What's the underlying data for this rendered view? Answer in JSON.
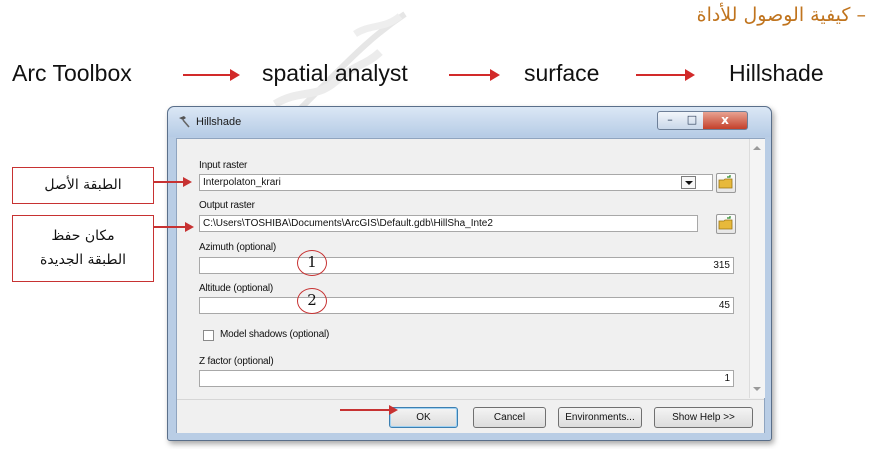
{
  "heading": "– كيفية الوصول للأداة",
  "path": {
    "steps": [
      "Arc Toolbox",
      "spatial analyst",
      "surface",
      "Hillshade"
    ]
  },
  "dialog": {
    "title": "Hillshade",
    "window_buttons": {
      "minimize": "–",
      "maximize": "□",
      "close": "x"
    },
    "input_raster": {
      "label": "Input raster",
      "value": "Interpolaton_krari"
    },
    "output_raster": {
      "label": "Output raster",
      "value": "C:\\Users\\TOSHIBA\\Documents\\ArcGIS\\Default.gdb\\HillSha_Inte2"
    },
    "azimuth": {
      "label": "Azimuth (optional)",
      "value": "315"
    },
    "altitude": {
      "label": "Altitude (optional)",
      "value": "45"
    },
    "model_shadows": {
      "label": "Model shadows (optional)",
      "checked": false
    },
    "z_factor": {
      "label": "Z factor (optional)",
      "value": "1"
    },
    "buttons": {
      "ok": "OK",
      "cancel": "Cancel",
      "environments": "Environments...",
      "show_help": "Show Help >>"
    }
  },
  "callouts": {
    "input": [
      "الطبقة الأصل"
    ],
    "output": [
      "مكان حفظ",
      "الطبقة الجديدة"
    ]
  },
  "markers": [
    "1",
    "2"
  ],
  "colors": {
    "accent_red": "#c73232",
    "heading": "#c0741e",
    "window_frame": "#b9cde5"
  }
}
